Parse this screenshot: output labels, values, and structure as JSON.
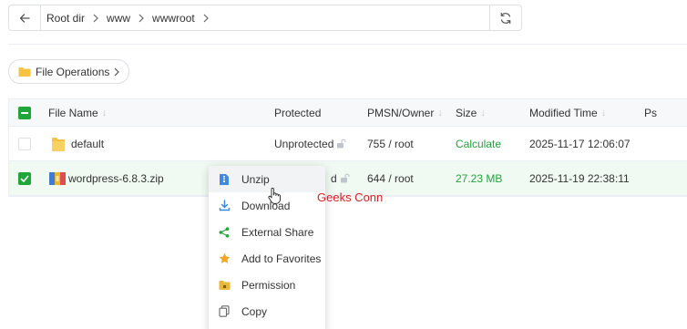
{
  "pathbar": {
    "crumbs": [
      "Root dir",
      "www",
      "wwwroot"
    ]
  },
  "file_operations": {
    "label": "File Operations"
  },
  "table": {
    "headers": {
      "file_name": "File Name",
      "protected": "Protected",
      "pmsn_owner": "PMSN/Owner",
      "size": "Size",
      "modified_time": "Modified Time",
      "ps": "Ps"
    },
    "rows": [
      {
        "selected": false,
        "icon": "folder-icon",
        "name": "default",
        "protected": "Unprotected",
        "pmsn_owner": "755 / root",
        "size": "Calculate",
        "modified_time": "2025-11-17 12:06:07"
      },
      {
        "selected": true,
        "icon": "zip-archive-icon",
        "name": "wordpress-6.8.3.zip",
        "protected": "d",
        "pmsn_owner": "644 / root",
        "size": "27.23 MB",
        "modified_time": "2025-11-19 22:38:11"
      }
    ]
  },
  "context_menu": {
    "items": [
      {
        "label": "Unzip",
        "icon": "unzip-icon"
      },
      {
        "label": "Download",
        "icon": "download-icon"
      },
      {
        "label": "External Share",
        "icon": "share-icon"
      },
      {
        "label": "Add to Favorites",
        "icon": "star-icon"
      },
      {
        "label": "Permission",
        "icon": "permission-folder-icon"
      },
      {
        "label": "Copy",
        "icon": "copy-icon"
      }
    ]
  },
  "watermark": "Geeks Conn",
  "colors": {
    "accent": "#20a53a",
    "border": "#dcdfe6",
    "watermark": "#d62020"
  }
}
